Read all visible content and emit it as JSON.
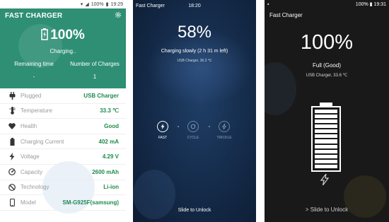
{
  "panel1": {
    "status": {
      "battery": "100%",
      "time": "19:29"
    },
    "app_title": "FAST CHARGER",
    "battery_percent": "100%",
    "charging_text": "Charging..",
    "remaining_label": "Remaining time",
    "remaining_value": "-",
    "charges_label": "Number of Charges",
    "charges_value": "1",
    "rows": [
      {
        "label": "Plugged",
        "value": "USB Charger",
        "icon": "plug-icon"
      },
      {
        "label": "Temperature",
        "value": "33.3 ℃",
        "icon": "thermometer-icon"
      },
      {
        "label": "Health",
        "value": "Good",
        "icon": "heart-icon"
      },
      {
        "label": "Charging Current",
        "value": "402 mA",
        "icon": "battery-icon"
      },
      {
        "label": "Voltage",
        "value": "4.29 V",
        "icon": "bolt-icon"
      },
      {
        "label": "Capacity",
        "value": "2600 mAh",
        "icon": "gauge-icon"
      },
      {
        "label": "Technology",
        "value": "Li-ion",
        "icon": "technology-icon"
      },
      {
        "label": "Model",
        "value": "SM-G925F(samsung)",
        "icon": "phone-icon"
      }
    ],
    "colors": {
      "accent": "#2e8f74",
      "value": "#1e8a50"
    }
  },
  "panel2": {
    "status_left": "Fast Charger",
    "status_time": "18:20",
    "percent": "58%",
    "status_text": "Charging slowly (2 h 31 m left)",
    "charger_info": "USB Charger, 36.3 ℃",
    "modes": [
      {
        "label": "FAST",
        "active": true
      },
      {
        "label": "CYCLE",
        "active": false
      },
      {
        "label": "TRICKLE",
        "active": false
      }
    ],
    "slide_text": "Slide to Unlock"
  },
  "panel3": {
    "status": {
      "battery": "100%",
      "time": "19:31"
    },
    "title": "Fast Charger",
    "percent": "100%",
    "health_text": "Full (Good)",
    "charger_info": "USB Charger, 33.6 ℃",
    "battery_level": 1.0,
    "slide_text": "> Slide to Unlock"
  }
}
